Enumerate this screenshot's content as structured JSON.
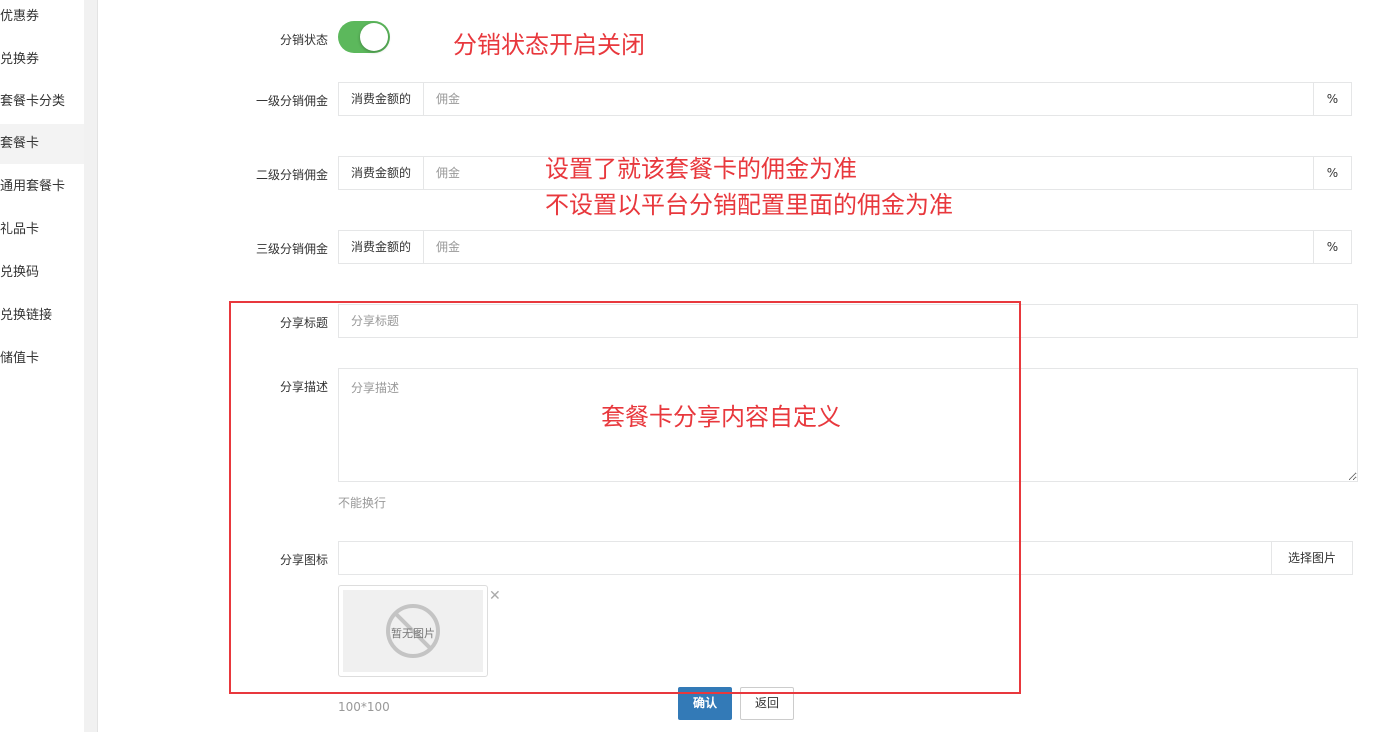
{
  "sidebar": {
    "items": [
      {
        "label": "优惠券"
      },
      {
        "label": "兑换券"
      },
      {
        "label": "套餐卡分类"
      },
      {
        "label": "套餐卡"
      },
      {
        "label": "通用套餐卡"
      },
      {
        "label": "礼品卡"
      },
      {
        "label": "兑换码"
      },
      {
        "label": "兑换链接"
      },
      {
        "label": "储值卡"
      }
    ],
    "active_index": 3
  },
  "form": {
    "distribution_status": {
      "label": "分销状态",
      "enabled": true,
      "on_color": "#5cb85c"
    },
    "commission_levels": [
      {
        "label": "一级分销佣金",
        "prefix": "消费金额的",
        "placeholder": "佣金",
        "suffix": "%"
      },
      {
        "label": "二级分销佣金",
        "prefix": "消费金额的",
        "placeholder": "佣金",
        "suffix": "%"
      },
      {
        "label": "三级分销佣金",
        "prefix": "消费金额的",
        "placeholder": "佣金",
        "suffix": "%"
      }
    ],
    "share_title": {
      "label": "分享标题",
      "placeholder": "分享标题"
    },
    "share_desc": {
      "label": "分享描述",
      "placeholder": "分享描述",
      "help": "不能换行"
    },
    "share_icon": {
      "label": "分享图标",
      "select_label": "选择图片",
      "no_image_text": "暂无图片",
      "size_hint": "100*100"
    },
    "confirm_label": "确认",
    "back_label": "返回"
  },
  "annotations": {
    "status_note": "分销状态开启关闭",
    "commission_note_1": "设置了就该套餐卡的佣金为准",
    "commission_note_2": "不设置以平台分销配置里面的佣金为准",
    "share_note": "套餐卡分享内容自定义",
    "color": "#e8383d"
  }
}
